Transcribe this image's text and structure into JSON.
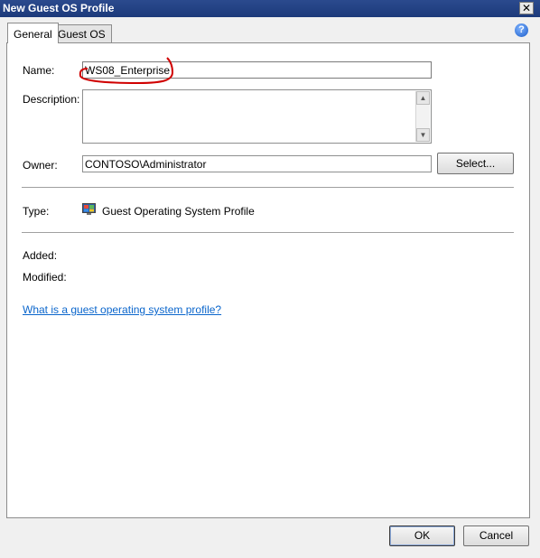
{
  "window": {
    "title": "New Guest OS Profile",
    "close_glyph": "✕"
  },
  "tabs": [
    {
      "label": "General",
      "active": true
    },
    {
      "label": "Guest OS",
      "active": false
    }
  ],
  "help_glyph": "?",
  "form": {
    "name_label": "Name:",
    "name_value": "WS08_Enterprise",
    "description_label": "Description:",
    "description_value": "",
    "owner_label": "Owner:",
    "owner_value": "CONTOSO\\Administrator",
    "select_button": "Select...",
    "type_label": "Type:",
    "type_value": "Guest Operating System Profile",
    "added_label": "Added:",
    "modified_label": "Modified:",
    "help_link": "What is a guest operating system profile?"
  },
  "footer": {
    "ok_label": "OK",
    "cancel_label": "Cancel"
  },
  "annotation": {
    "color": "#d00000"
  }
}
